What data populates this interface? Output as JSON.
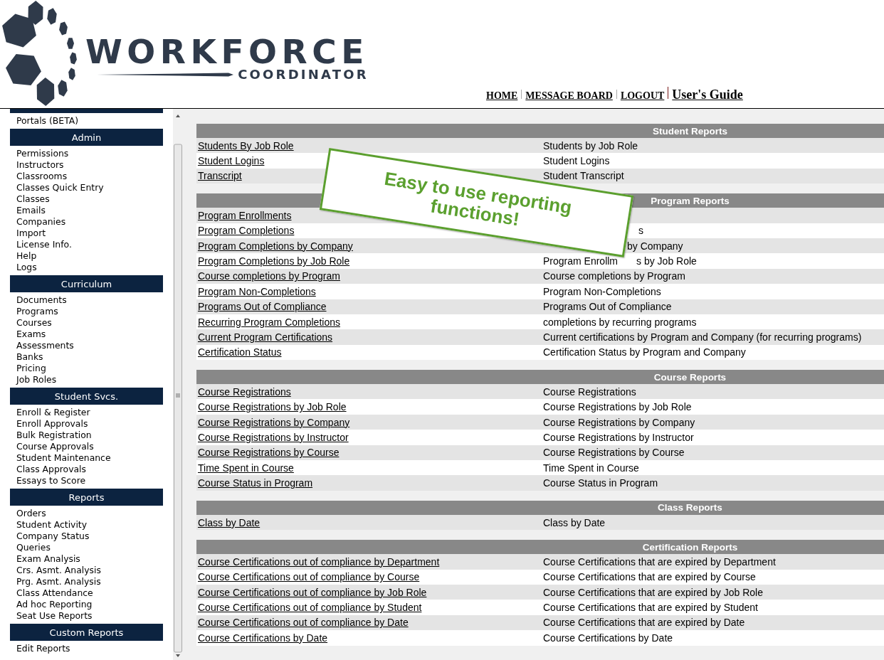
{
  "logo": {
    "name": "WORKFORCE",
    "tagline": "COORDINATOR"
  },
  "nav": [
    {
      "label": "HOME",
      "kind": "link"
    },
    {
      "label": "MESSAGE BOARD",
      "kind": "link"
    },
    {
      "label": "LOGOUT",
      "kind": "link"
    },
    {
      "label": "User's Guide",
      "kind": "guide"
    }
  ],
  "sidebar": {
    "top_items": [
      "Portals (BETA)"
    ],
    "sections": [
      {
        "title": "Admin",
        "items": [
          "Permissions",
          "Instructors",
          "Classrooms",
          "Classes Quick Entry",
          "Classes",
          "Emails",
          "Companies",
          "Import",
          "License Info.",
          "Help",
          "Logs"
        ]
      },
      {
        "title": "Curriculum",
        "items": [
          "Documents",
          "Programs",
          "Courses",
          "Exams",
          "Assessments",
          "Banks",
          "Pricing",
          "Job Roles"
        ]
      },
      {
        "title": "Student Svcs.",
        "items": [
          "Enroll & Register",
          "Enroll Approvals",
          "Bulk Registration",
          "Course Approvals",
          "Student Maintenance",
          "Class Approvals",
          "Essays to Score"
        ]
      },
      {
        "title": "Reports",
        "items": [
          "Orders",
          "Student Activity",
          "Company Status",
          "Queries",
          "Exam Analysis",
          "Crs. Asmt. Analysis",
          "Prg. Asmt. Analysis",
          "Class Attendance",
          "Ad hoc Reporting",
          "Seat Use Reports"
        ]
      },
      {
        "title": "Custom Reports",
        "items": [
          "Edit Reports"
        ]
      }
    ]
  },
  "reports": [
    {
      "title": "Student Reports",
      "rows": [
        {
          "link": "Students By Job Role",
          "description": "Students by Job Role"
        },
        {
          "link": "Student Logins",
          "description": "Student Logins"
        },
        {
          "link": "Transcript",
          "description": "Student Transcript"
        }
      ]
    },
    {
      "title": "Program Reports",
      "rows": [
        {
          "link": "Program Enrollments"
        },
        {
          "link": "Program Completions",
          "description_tail": "s"
        },
        {
          "link": "Program Completions by Company",
          "description_tail": "by Company"
        },
        {
          "link": "Program Completions by Job Role",
          "description": "Program Enrollm",
          "description_tail": "s by Job Role"
        },
        {
          "link": "Course completions by Program",
          "description": "Course completions by Program"
        },
        {
          "link": "Program Non-Completions",
          "description": "Program Non-Completions"
        },
        {
          "link": "Programs Out of Compliance",
          "description": "Programs Out of Compliance"
        },
        {
          "link": "Recurring Program Completions",
          "description": "completions by recurring programs"
        },
        {
          "link": "Current Program Certifications",
          "description": "Current certifications by Program and Company (for recurring programs)"
        },
        {
          "link": "Certification Status",
          "description": "Certification Status by Program and Company"
        }
      ]
    },
    {
      "title": "Course Reports",
      "rows": [
        {
          "link": "Course Registrations",
          "description": "Course Registrations"
        },
        {
          "link": "Course Registrations by Job Role",
          "description": "Course Registrations by Job Role"
        },
        {
          "link": "Course Registrations by Company",
          "description": "Course Registrations by Company"
        },
        {
          "link": "Course Registrations by Instructor",
          "description": "Course Registrations by Instructor"
        },
        {
          "link": "Course Registrations by Course",
          "description": "Course Registrations by Course"
        },
        {
          "link": "Time Spent in Course",
          "description": "Time Spent in Course"
        },
        {
          "link": "Course Status in Program",
          "description": "Course Status in Program"
        }
      ]
    },
    {
      "title": "Class Reports",
      "rows": [
        {
          "link": "Class by Date",
          "description": "Class by Date"
        }
      ]
    },
    {
      "title": "Certification Reports",
      "rows": [
        {
          "link": "Course Certifications out of compliance by Department",
          "description": "Course Certifications that are expired by Department"
        },
        {
          "link": "Course Certifications out of compliance by Course",
          "description": "Course Certifications that are expired by Course"
        },
        {
          "link": "Course Certifications out of compliance by Job Role",
          "description": "Course Certifications that are expired by Job Role"
        },
        {
          "link": "Course Certifications out of compliance by Student",
          "description": "Course Certifications that are expired by Student"
        },
        {
          "link": "Course Certifications out of compliance by Date",
          "description": "Course Certifications that are expired by Date"
        },
        {
          "link": "Course Certifications by Date",
          "description": "Course Certifications by Date"
        }
      ]
    }
  ],
  "callout": {
    "text": "Easy to use reporting functions!"
  }
}
